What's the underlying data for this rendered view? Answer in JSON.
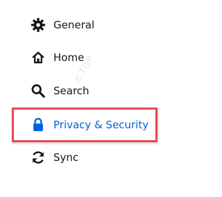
{
  "sidebar": {
    "items": [
      {
        "label": "General",
        "icon": "gear-icon"
      },
      {
        "label": "Home",
        "icon": "home-icon"
      },
      {
        "label": "Search",
        "icon": "search-icon"
      },
      {
        "label": "Privacy & Security",
        "icon": "lock-icon",
        "selected": true
      },
      {
        "label": "Sync",
        "icon": "sync-icon"
      }
    ]
  },
  "watermark": {
    "text": "©TGP"
  },
  "colors": {
    "selected_accent": "#0061e0",
    "highlight_border": "#e8474f",
    "text": "#15141a"
  }
}
